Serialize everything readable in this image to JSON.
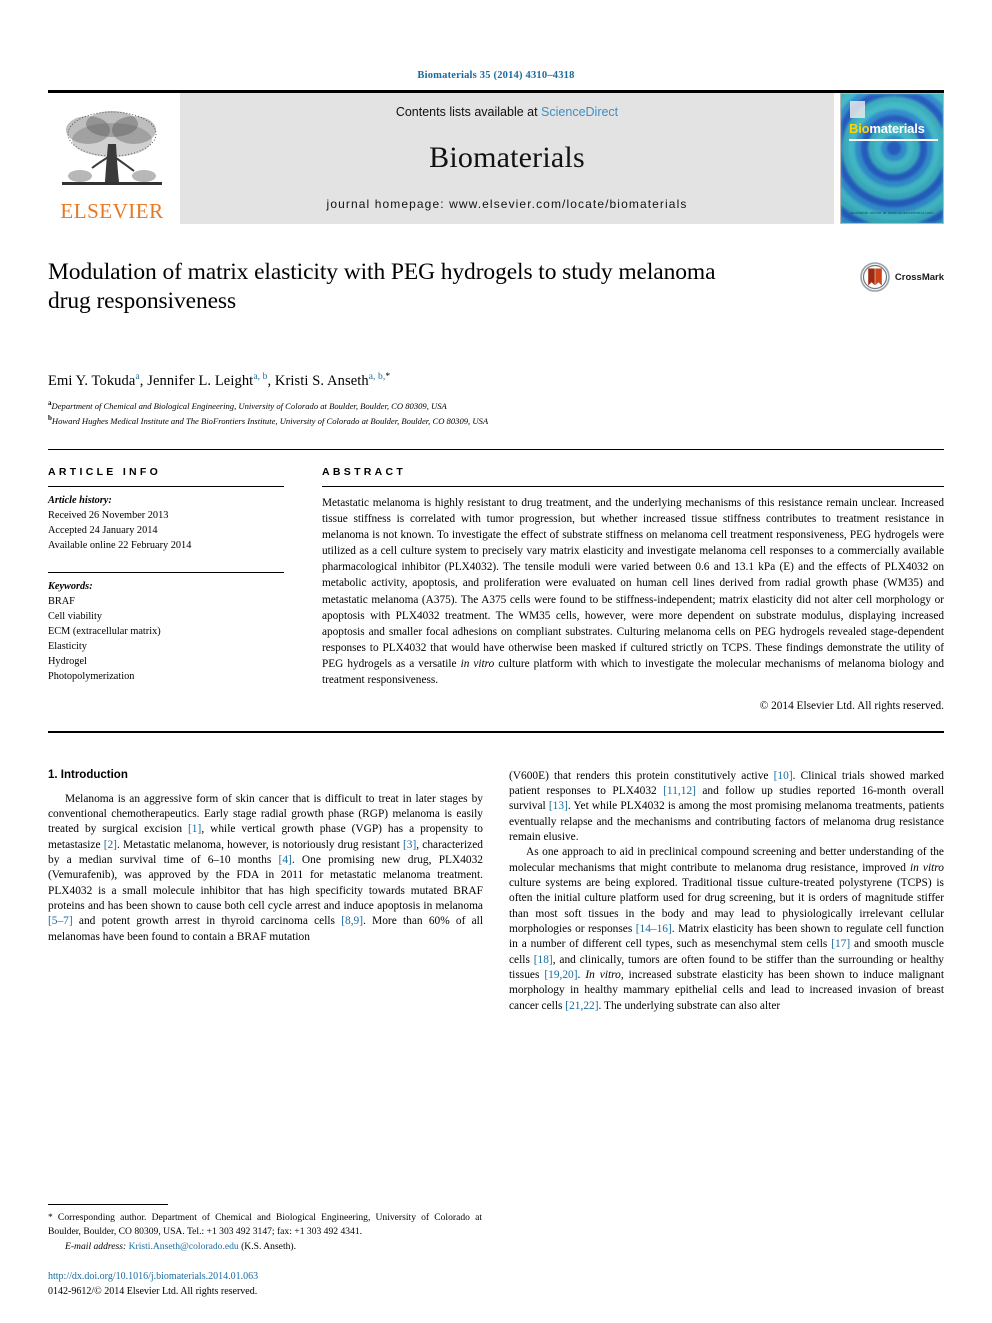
{
  "running_head": "Biomaterials 35 (2014) 4310–4318",
  "masthead": {
    "publisher_name": "ELSEVIER",
    "contents_prefix": "Contents lists available at ",
    "contents_link": "ScienceDirect",
    "journal_name": "Biomaterials",
    "homepage_line": "journal homepage: www.elsevier.com/locate/biomaterials",
    "cover": {
      "title_first": "Bio",
      "title_rest": "materials",
      "footline": "Available online at www.sciencedirect.com"
    }
  },
  "article": {
    "title": "Modulation of matrix elasticity with PEG hydrogels to study melanoma drug responsiveness",
    "crossmark_label": "CrossMark",
    "authors_html": "Emi Y. Tokuda<sup>a</sup>, Jennifer L. Leight<sup>a, b</sup>, Kristi S. Anseth<sup>a, b,</sup><sup class=\"ast\">*</sup>",
    "affiliations": [
      {
        "mark": "a",
        "text": "Department of Chemical and Biological Engineering, University of Colorado at Boulder, Boulder, CO 80309, USA"
      },
      {
        "mark": "b",
        "text": "Howard Hughes Medical Institute and The BioFrontiers Institute, University of Colorado at Boulder, Boulder, CO 80309, USA"
      }
    ]
  },
  "article_info": {
    "label": "ARTICLE INFO",
    "history_header": "Article history:",
    "history": [
      "Received 26 November 2013",
      "Accepted 24 January 2014",
      "Available online 22 February 2014"
    ],
    "keywords_header": "Keywords:",
    "keywords": [
      "BRAF",
      "Cell viability",
      "ECM (extracellular matrix)",
      "Elasticity",
      "Hydrogel",
      "Photopolymerization"
    ]
  },
  "abstract": {
    "label": "ABSTRACT",
    "text": "Metastatic melanoma is highly resistant to drug treatment, and the underlying mechanisms of this resistance remain unclear. Increased tissue stiffness is correlated with tumor progression, but whether increased tissue stiffness contributes to treatment resistance in melanoma is not known. To investigate the effect of substrate stiffness on melanoma cell treatment responsiveness, PEG hydrogels were utilized as a cell culture system to precisely vary matrix elasticity and investigate melanoma cell responses to a commercially available pharmacological inhibitor (PLX4032). The tensile moduli were varied between 0.6 and 13.1 kPa (E) and the effects of PLX4032 on metabolic activity, apoptosis, and proliferation were evaluated on human cell lines derived from radial growth phase (WM35) and metastatic melanoma (A375). The A375 cells were found to be stiffness-independent; matrix elasticity did not alter cell morphology or apoptosis with PLX4032 treatment. The WM35 cells, however, were more dependent on substrate modulus, displaying increased apoptosis and smaller focal adhesions on compliant substrates. Culturing melanoma cells on PEG hydrogels revealed stage-dependent responses to PLX4032 that would have otherwise been masked if cultured strictly on TCPS. These findings demonstrate the utility of PEG hydrogels as a versatile in vitro culture platform with which to investigate the molecular mechanisms of melanoma biology and treatment responsiveness.",
    "copyright": "© 2014 Elsevier Ltd. All rights reserved."
  },
  "introduction": {
    "heading": "1. Introduction",
    "left_paragraphs": [
      "Melanoma is an aggressive form of skin cancer that is difficult to treat in later stages by conventional chemotherapeutics. Early stage radial growth phase (RGP) melanoma is easily treated by surgical excision [1], while vertical growth phase (VGP) has a propensity to metastasize [2]. Metastatic melanoma, however, is notoriously drug resistant [3], characterized by a median survival time of 6–10 months [4]. One promising new drug, PLX4032 (Vemurafenib), was approved by the FDA in 2011 for metastatic melanoma treatment. PLX4032 is a small molecule inhibitor that has high specificity towards mutated BRAF proteins and has been shown to cause both cell cycle arrest and induce apoptosis in melanoma [5–7] and potent growth arrest in thyroid carcinoma cells [8,9]. More than 60% of all melanomas have been found to contain a BRAF mutation"
    ],
    "right_paragraphs": [
      "(V600E) that renders this protein constitutively active [10]. Clinical trials showed marked patient responses to PLX4032 [11,12] and follow up studies reported 16-month overall survival [13]. Yet while PLX4032 is among the most promising melanoma treatments, patients eventually relapse and the mechanisms and contributing factors of melanoma drug resistance remain elusive.",
      "As one approach to aid in preclinical compound screening and better understanding of the molecular mechanisms that might contribute to melanoma drug resistance, improved in vitro culture systems are being explored. Traditional tissue culture-treated polystyrene (TCPS) is often the initial culture platform used for drug screening, but it is orders of magnitude stiffer than most soft tissues in the body and may lead to physiologically irrelevant cellular morphologies or responses [14–16]. Matrix elasticity has been shown to regulate cell function in a number of different cell types, such as mesenchymal stem cells [17] and smooth muscle cells [18], and clinically, tumors are often found to be stiffer than the surrounding or healthy tissues [19,20]. In vitro, increased substrate elasticity has been shown to induce malignant morphology in healthy mammary epithelial cells and lead to increased invasion of breast cancer cells [21,22]. The underlying substrate can also alter"
    ]
  },
  "footnotes": {
    "corresponding": "* Corresponding author. Department of Chemical and Biological Engineering, University of Colorado at Boulder, Boulder, CO 80309, USA. Tel.: +1 303 492 3147; fax: +1 303 492 4341.",
    "email_label": "E-mail address:",
    "email": "Kristi.Anseth@colorado.edu",
    "email_suffix": " (K.S. Anseth).",
    "doi": "http://dx.doi.org/10.1016/j.biomaterials.2014.01.063",
    "issn_line": "0142-9612/© 2014 Elsevier Ltd. All rights reserved."
  },
  "colors": {
    "link": "#1a6ba0",
    "elsevier_orange": "#E87722",
    "sciencedirect_blue": "#3c8fc4",
    "band_gray": "#e3e3e3"
  }
}
